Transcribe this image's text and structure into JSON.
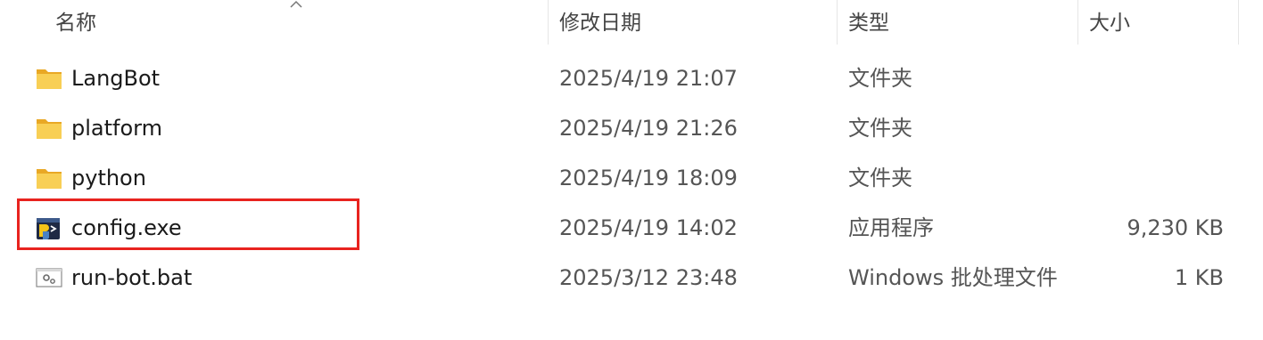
{
  "columns": {
    "name": "名称",
    "date": "修改日期",
    "type": "类型",
    "size": "大小"
  },
  "files": [
    {
      "name": "LangBot",
      "date": "2025/4/19 21:07",
      "type": "文件夹",
      "size": "",
      "icon": "folder-icon"
    },
    {
      "name": "platform",
      "date": "2025/4/19 21:26",
      "type": "文件夹",
      "size": "",
      "icon": "folder-icon"
    },
    {
      "name": "python",
      "date": "2025/4/19 18:09",
      "type": "文件夹",
      "size": "",
      "icon": "folder-icon"
    },
    {
      "name": "config.exe",
      "date": "2025/4/19 14:02",
      "type": "应用程序",
      "size": "9,230 KB",
      "icon": "python-exe-icon"
    },
    {
      "name": "run-bot.bat",
      "date": "2025/3/12 23:48",
      "type": "Windows 批处理文件",
      "size": "1 KB",
      "icon": "batch-file-icon"
    }
  ],
  "colors": {
    "highlight": "#e8231f",
    "folder": "#f4c243"
  }
}
